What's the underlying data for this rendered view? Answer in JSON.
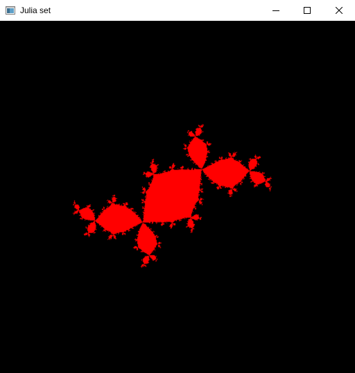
{
  "window": {
    "title": "Julia set",
    "app_icon": "window-app-icon"
  },
  "title_bar_controls": {
    "minimize_icon": "minimize-icon",
    "maximize_icon": "maximize-icon",
    "close_icon": "close-icon"
  },
  "canvas": {
    "background_color": "#000000",
    "fractal_color": "#ff0000"
  }
}
